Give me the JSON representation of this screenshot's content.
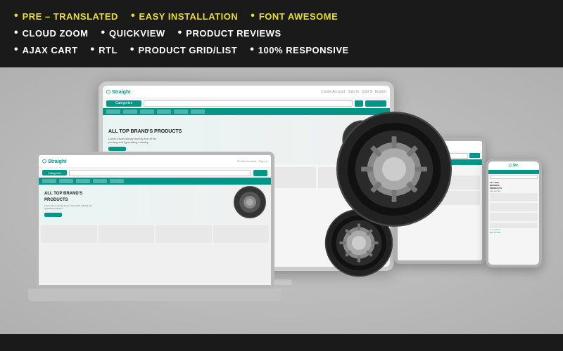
{
  "features": {
    "row1": [
      {
        "bullet": "•",
        "text": "PRE – TRANSLATED",
        "color": "yellow"
      },
      {
        "bullet": "•",
        "text": "EASY INSTALLATION",
        "color": "yellow"
      },
      {
        "bullet": "•",
        "text": "FONT AWESOME",
        "color": "yellow"
      }
    ],
    "row2": [
      {
        "bullet": "•",
        "text": "CLOUD ZOOM",
        "color": "white"
      },
      {
        "bullet": "•",
        "text": "QUICKVIEW",
        "color": "white"
      },
      {
        "bullet": "•",
        "text": "PRODUCT REVIEWS",
        "color": "white"
      }
    ],
    "row3": [
      {
        "bullet": "•",
        "text": "AJAX CART",
        "color": "white"
      },
      {
        "bullet": "•",
        "text": "RTL",
        "color": "white"
      },
      {
        "bullet": "•",
        "text": "PRODUCT GRID/LIST",
        "color": "white"
      },
      {
        "bullet": "•",
        "text": "100% RESPONSIVE",
        "color": "white"
      }
    ]
  },
  "preview": {
    "brand": "Straight",
    "tagline": "ALL TOP BRAND'S PRODUCTS",
    "description": "Lorem ipsum simply dummy text of the printing and typesetting industry.",
    "cta": "SHOP NOW",
    "teal_color": "#009688"
  }
}
